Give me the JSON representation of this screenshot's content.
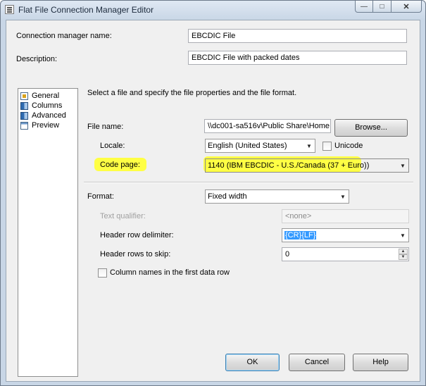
{
  "window": {
    "title": "Flat File Connection Manager Editor"
  },
  "connection_name": {
    "label": "Connection manager name:",
    "value": "EBCDIC File"
  },
  "description": {
    "label": "Description:",
    "value": "EBCDIC File with packed dates"
  },
  "nav": {
    "items": [
      "General",
      "Columns",
      "Advanced",
      "Preview"
    ]
  },
  "general": {
    "instruction": "Select a file and specify the file properties and the file format.",
    "file_name": {
      "label": "File name:",
      "value": "\\\\dc001-sa516v\\Public Share\\Home Di"
    },
    "browse_label": "Browse...",
    "locale": {
      "label": "Locale:",
      "value": "English (United States)"
    },
    "unicode": {
      "label": "Unicode",
      "checked": false
    },
    "code_page": {
      "label": "Code page:",
      "value": "1140  (IBM EBCDIC - U.S./Canada (37 + Euro))"
    },
    "format": {
      "label": "Format:",
      "value": "Fixed width"
    },
    "text_qualifier": {
      "label": "Text qualifier:",
      "value": "<none>"
    },
    "header_row_delimiter": {
      "label": "Header row delimiter:",
      "value": "{CR}{LF}"
    },
    "header_rows_to_skip": {
      "label": "Header rows to skip:",
      "value": "0"
    },
    "column_names": {
      "label": "Column names in the first data row",
      "checked": false
    }
  },
  "footer": {
    "ok_label": "OK",
    "cancel_label": "Cancel",
    "help_label": "Help"
  },
  "colors": {
    "highlight": "#ffff3a",
    "selection": "#3399ff"
  }
}
